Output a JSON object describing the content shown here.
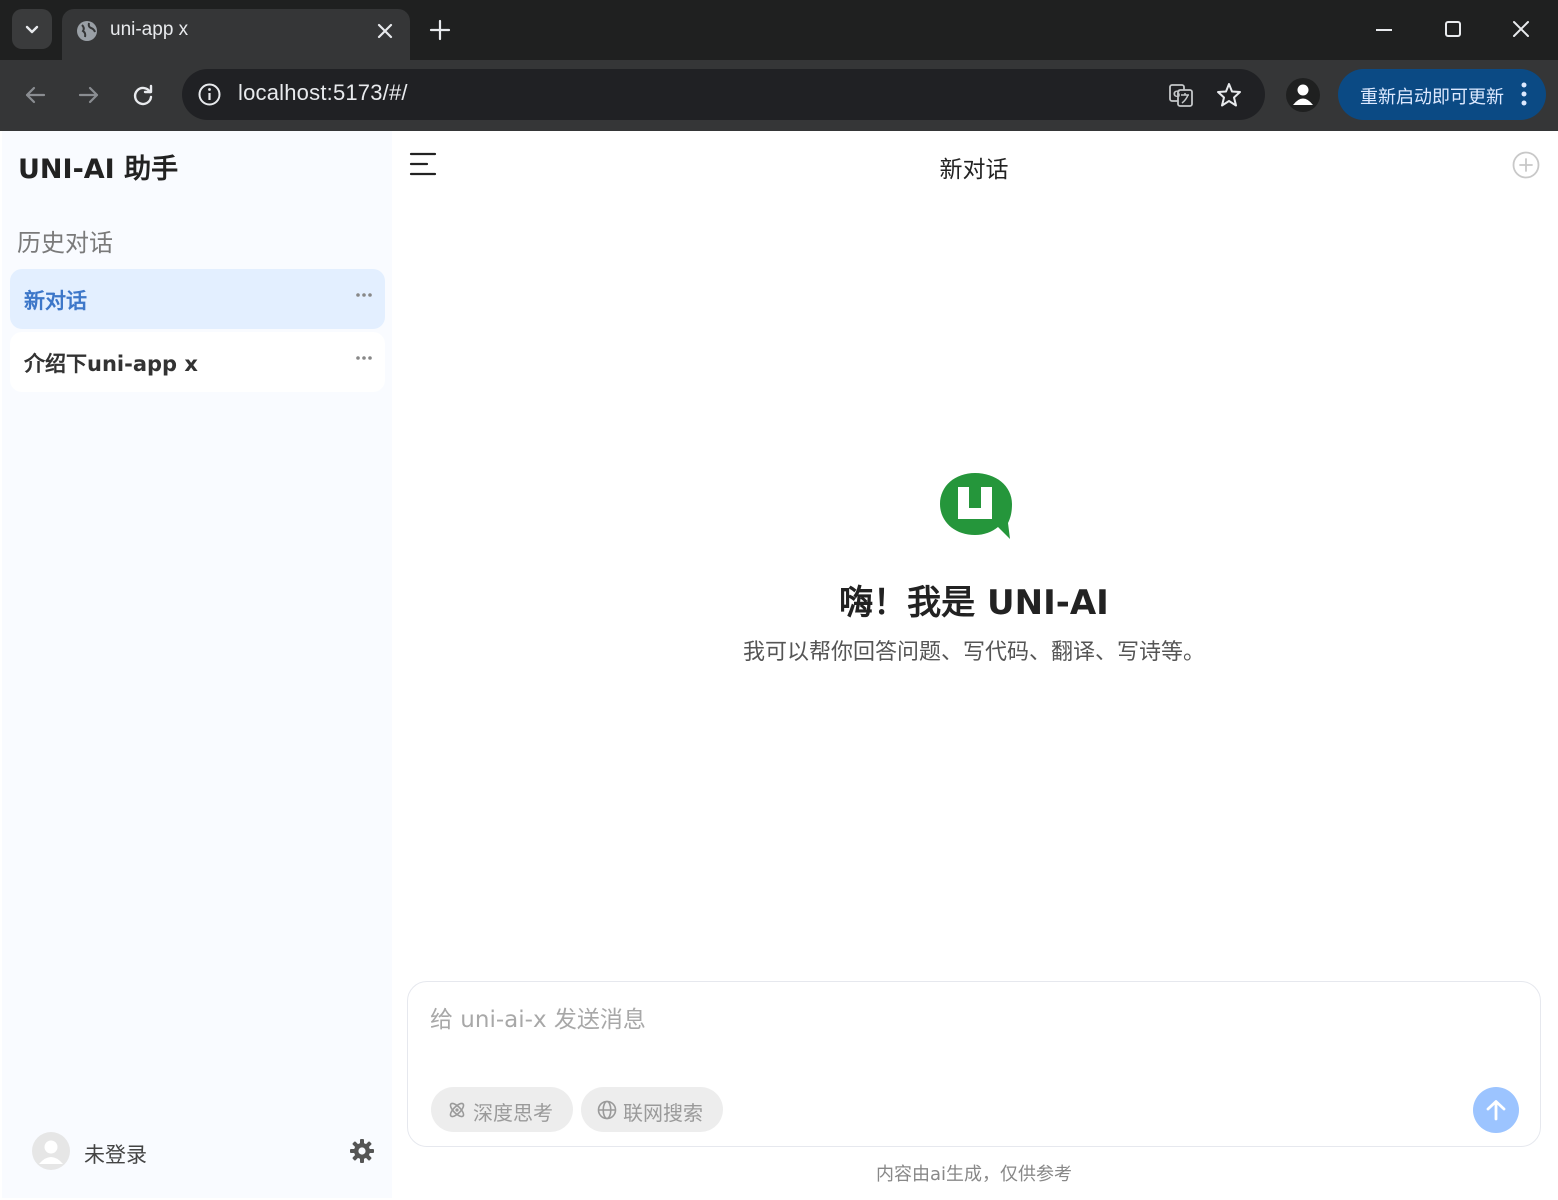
{
  "browser": {
    "tab_title": "uni-app x",
    "url": "localhost:5173/#/",
    "update_button_label": "重新启动即可更新"
  },
  "sidebar": {
    "app_title": "UNI-AI 助手",
    "history_title": "历史对话",
    "conversations": [
      {
        "label": "新对话",
        "active": true
      },
      {
        "label": "介绍下uni-app x",
        "active": false
      }
    ],
    "user_name": "未登录"
  },
  "main": {
    "chat_title": "新对话",
    "welcome": {
      "title": "嗨！我是 UNI-AI",
      "subtitle": "我可以帮你回答问题、写代码、翻译、写诗等。"
    },
    "composer": {
      "placeholder": "给 uni-ai-x 发送消息",
      "deep_think_label": "深度思考",
      "web_search_label": "联网搜索"
    },
    "disclaimer": "内容由ai生成，仅供参考"
  },
  "colors": {
    "accent": "#3d77c9",
    "active_item_bg": "#e3efff",
    "logo_green": "#25963b",
    "send_button": "#9cc4ff",
    "update_button": "#0b4a84"
  }
}
